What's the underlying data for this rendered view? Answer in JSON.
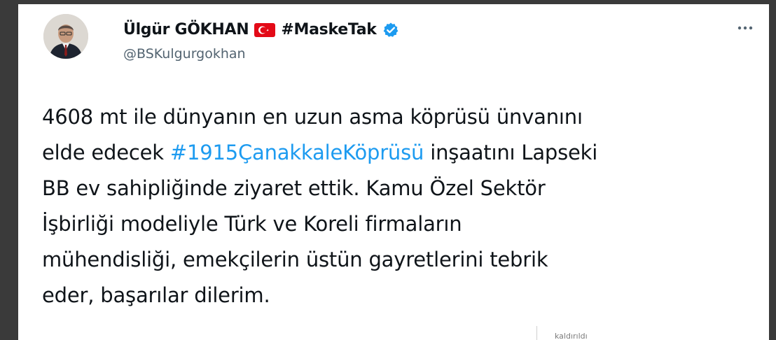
{
  "author": {
    "display_name": "Ülgür GÖKHAN",
    "flag": "turkey-flag",
    "name_hashtag": "#MaskeTak",
    "verified": true,
    "handle": "@BSKulgurgokhan",
    "avatar": "profile-photo"
  },
  "more_menu": {
    "icon": "more-options-icon",
    "label": "···"
  },
  "tweet": {
    "line1": "4608 mt ile dünyanın en uzun asma köprüsü ünvanını",
    "line2_before": "elde edecek ",
    "line2_hashtag": "#1915ÇanakkaleKöprüsü",
    "line2_after": " inşaatını Lapseki",
    "line3": "BB ev sahipliğinde ziyaret ettik. Kamu Özel Sektör",
    "line4": "İşbirliği modeliyle Türk ve Koreli firmaların",
    "line5": "mühendisliği,  emekçilerin üstün gayretlerini tebrik",
    "line6": "eder, başarılar dilerim."
  },
  "colors": {
    "background": "#3a3a3a",
    "card": "#ffffff",
    "text": "#0f1419",
    "secondary": "#536471",
    "link": "#1d9bf0",
    "verified": "#1d9bf0",
    "flag_red": "#e30a17"
  },
  "footer_fragment": "kaldırıldı"
}
